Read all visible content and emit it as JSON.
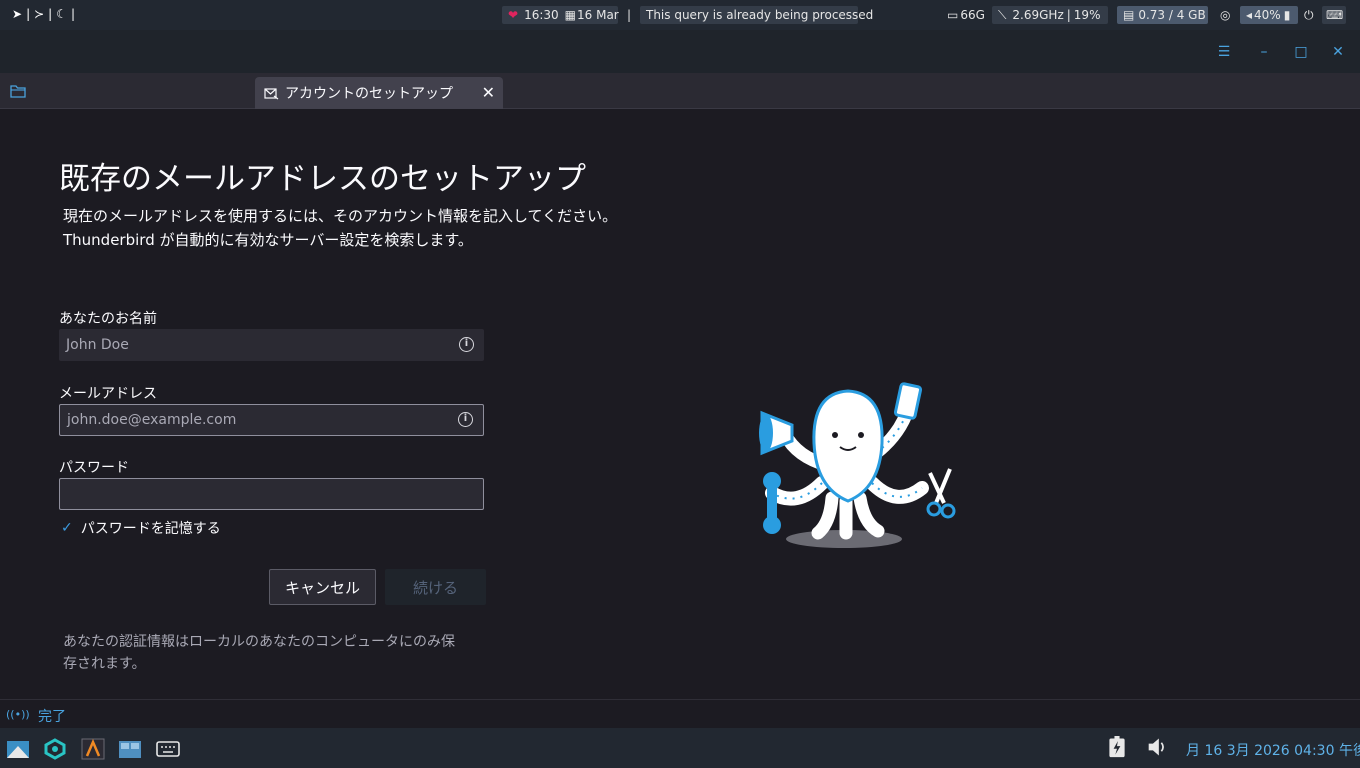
{
  "topbar": {
    "launchers": [
      "➤",
      "|",
      "≻",
      "|",
      "☾",
      "|"
    ],
    "time": "16:30",
    "date": "16 Mar",
    "separator": "|",
    "notification": "This query is already being processed",
    "disk": "66G",
    "cpu_freq": "2.69GHz",
    "cpu_sep": "|",
    "cpu_usage": "19%",
    "memory": "0.73 / 4 GB",
    "volume": "40%"
  },
  "window": {
    "buttons": [
      "☰",
      "–",
      "□",
      "✕"
    ]
  },
  "tab": {
    "label": "アカウントのセットアップ",
    "close": "✕"
  },
  "page": {
    "title": "既存のメールアドレスのセットアップ",
    "desc_line1": "現在のメールアドレスを使用するには、そのアカウント情報を記入してください。",
    "desc_line2": "Thunderbird が自動的に有効なサーバー設定を検索します。",
    "name_label": "あなたのお名前",
    "name_placeholder": "John Doe",
    "email_label": "メールアドレス",
    "email_placeholder": "john.doe@example.com",
    "password_label": "パスワード",
    "password_value": "",
    "remember_label": "パスワードを記憶する",
    "remember_checked": true,
    "cancel_label": "キャンセル",
    "continue_label": "続ける",
    "note_line1": "あなたの認証情報はローカルのあなたのコンピュータにのみ保",
    "note_line2": "存されます。"
  },
  "status": {
    "text": "完了"
  },
  "taskbar": {
    "clock": "月 16  3月 2026 04:30 午後"
  }
}
